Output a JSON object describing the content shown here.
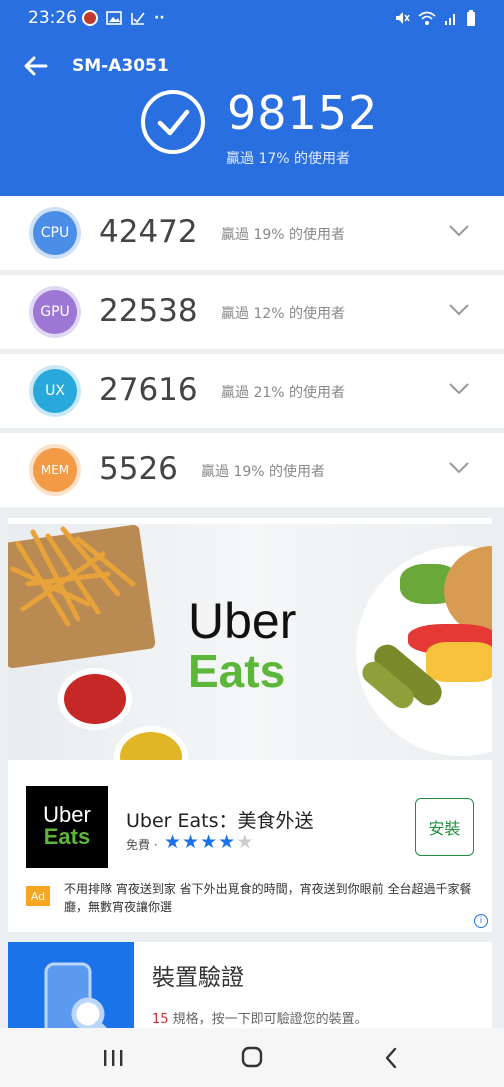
{
  "status_bar": {
    "time": "23:26",
    "left_icons": [
      "notification-app-icon",
      "gallery-icon",
      "task-icon",
      "more-dots-icon"
    ],
    "right_icons": [
      "mute-icon",
      "wifi-icon",
      "signal-icon",
      "battery-icon"
    ]
  },
  "header": {
    "device_name": "SM-A3051",
    "total_score": "98152",
    "total_subtitle": "贏過 17% 的使用者",
    "color": "#2a6fe0"
  },
  "scores": [
    {
      "badge": "CPU",
      "value": "42472",
      "subtitle": "贏過 19% 的使用者",
      "color": "#4a8ee8"
    },
    {
      "badge": "GPU",
      "value": "22538",
      "subtitle": "贏過 12% 的使用者",
      "color": "#9c77d6"
    },
    {
      "badge": "UX",
      "value": "27616",
      "subtitle": "贏過 21% 的使用者",
      "color": "#28a8db"
    },
    {
      "badge": "MEM",
      "value": "5526",
      "subtitle": "贏過 19% 的使用者",
      "color": "#f29a45"
    }
  ],
  "ad": {
    "banner_word1": "Uber",
    "banner_word2": "Eats",
    "logo_word1": "Uber",
    "logo_word2": "Eats",
    "app_name": "Uber Eats：美食外送",
    "price": "免費 ·",
    "rating": 4,
    "rating_max": 5,
    "install_label": "安裝",
    "ad_badge": "Ad",
    "description": "不用排隊 宵夜送到家 省下外出覓食的時間，宵夜送到你眼前 全台超過千家餐廳，無數宵夜讓你選",
    "adchoices": "i"
  },
  "verify": {
    "title": "裝置驗證",
    "count": "15",
    "subtitle": " 規格，按一下即可驗證您的裝置。"
  },
  "navbar": {
    "icons": [
      "recent-apps-icon",
      "home-icon",
      "back-nav-icon"
    ]
  }
}
